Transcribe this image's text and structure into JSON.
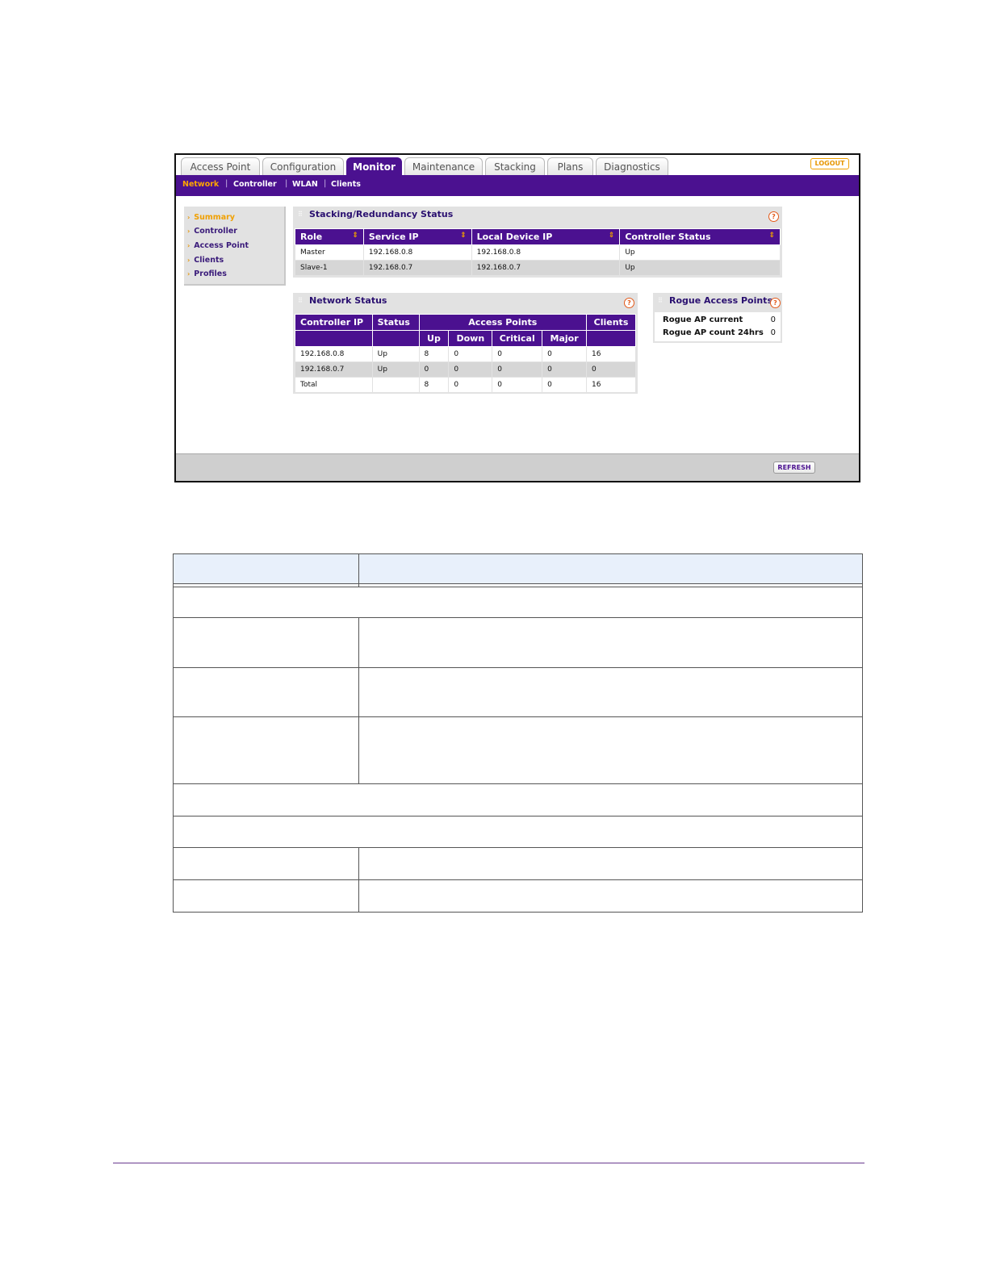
{
  "tabs": [
    "Access Point",
    "Configuration",
    "Monitor",
    "Maintenance",
    "Stacking",
    "Plans",
    "Diagnostics"
  ],
  "active_tab": "Monitor",
  "logout_label": "LOGOUT",
  "subnav": [
    "Network",
    "Controller",
    "WLAN",
    "Clients"
  ],
  "active_subnav": "Network",
  "leftnav": [
    "Summary",
    "Controller",
    "Access Point",
    "Clients",
    "Profiles"
  ],
  "active_leftnav": "Summary",
  "stacking": {
    "title": "Stacking/Redundancy Status",
    "columns": [
      "Role",
      "Service IP",
      "Local Device IP",
      "Controller Status"
    ],
    "rows": [
      [
        "Master",
        "192.168.0.8",
        "192.168.0.8",
        "Up"
      ],
      [
        "Slave-1",
        "192.168.0.7",
        "192.168.0.7",
        "Up"
      ]
    ]
  },
  "network_status": {
    "title": "Network Status",
    "columns": [
      "Controller IP",
      "Status",
      "Access Points",
      "Clients"
    ],
    "ap_subcolumns": [
      "Up",
      "Down",
      "Critical",
      "Major"
    ],
    "rows": [
      [
        "192.168.0.8",
        "Up",
        "8",
        "0",
        "0",
        "0",
        "16"
      ],
      [
        "192.168.0.7",
        "Up",
        "0",
        "0",
        "0",
        "0",
        "0"
      ],
      [
        "Total",
        "",
        "8",
        "0",
        "0",
        "0",
        "16"
      ]
    ]
  },
  "rogue": {
    "title": "Rogue Access Points",
    "rows": [
      {
        "label": "Rogue AP current",
        "value": "0"
      },
      {
        "label": "Rogue AP count 24hrs",
        "value": "0"
      }
    ]
  },
  "refresh_label": "REFRESH",
  "colors": {
    "brand_purple": "#4b1190",
    "accent_orange": "#f0a000",
    "panel_gray": "#e2e2e2"
  },
  "help_icon": "?"
}
